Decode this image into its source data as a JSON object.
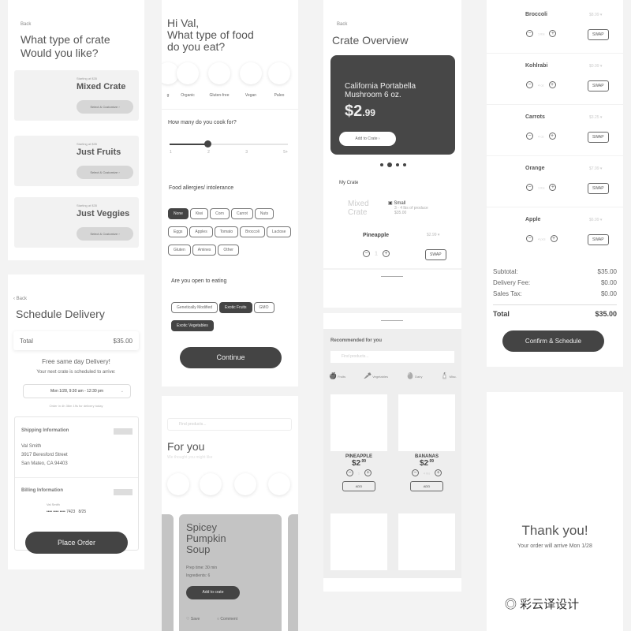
{
  "crate_select": {
    "back": "Back",
    "title_l1": "What type of crate",
    "title_l2": "Would you like?",
    "cards": [
      {
        "starting": "Starting at $35",
        "name": "Mixed Crate",
        "button": "Select & Customize"
      },
      {
        "starting": "Starting at $35",
        "name": "Just Fruits",
        "button": "Select & Customize"
      },
      {
        "starting": "Starting at $35",
        "name": "Just Veggies",
        "button": "Select & Customize"
      }
    ]
  },
  "food_prefs": {
    "title_l1": "Hi Val,",
    "title_l2": "What type of food",
    "title_l3": "do you eat?",
    "diets": [
      "g",
      "Organic",
      "Gluten-free",
      "Vegan",
      "Paleo"
    ],
    "cook_question": "How many do you cook for?",
    "slider_ticks": [
      "1",
      "2",
      "3",
      "5+"
    ],
    "slider_value": "2",
    "allergy_title": "Food allergies/ intolerance",
    "allergies": [
      {
        "l": "None",
        "on": true
      },
      {
        "l": "Kiwi"
      },
      {
        "l": "Corn"
      },
      {
        "l": "Carrot"
      },
      {
        "l": "Nuts"
      },
      {
        "l": "Eggs"
      },
      {
        "l": "Apples"
      },
      {
        "l": "Tomato"
      },
      {
        "l": "Broccoli"
      },
      {
        "l": "Lactose"
      },
      {
        "l": "Gluten"
      },
      {
        "l": "Amines"
      },
      {
        "l": "Other"
      }
    ],
    "open_title": "Are you open to eating",
    "open": [
      {
        "l": "Genetically Modified"
      },
      {
        "l": "Exotic Fruits",
        "on": true
      },
      {
        "l": "GMO"
      },
      {
        "l": "Exotic Vegetables",
        "on": true
      }
    ],
    "continue": "Continue"
  },
  "overview": {
    "back": "Back",
    "title": "Crate Overview",
    "featured_l1": "California Portabella",
    "featured_l2": "Mushroom 6 oz.",
    "price_main": "$2",
    "price_cents": ".99",
    "add": "Add to Crate",
    "my_crate": "My Crate",
    "crate_name_l1": "Mixed",
    "crate_name_l2": "Crate",
    "size": "Small",
    "size_desc": "3 - 4 lbs of produce",
    "size_price": "$35.00",
    "item": {
      "name": "Pineapple",
      "price": "$2.99",
      "qty": "1",
      "swap": "SWAP"
    }
  },
  "crate_list": {
    "items": [
      {
        "name": "Broccoli",
        "price": "$8.99",
        "qty": "1 lbs"
      },
      {
        "name": "Kohlrabi",
        "price": "$0.99",
        "qty": "4 oz"
      },
      {
        "name": "Carrots",
        "price": "$3.25",
        "qty": "4 oz"
      },
      {
        "name": "Orange",
        "price": "$7.99",
        "qty": "1 lbs"
      },
      {
        "name": "Apple",
        "price": "$6.99",
        "qty": "4 pcs"
      }
    ],
    "swap": "SWAP",
    "subtotal_label": "Subtotal:",
    "subtotal": "$35.00",
    "fee_label": "Delivery Fee:",
    "fee": "$0.00",
    "tax_label": "Sales Tax:",
    "tax": "$0.00",
    "total_label": "Total",
    "total": "$35.00",
    "confirm": "Confirm & Schedule"
  },
  "schedule": {
    "back": "Back",
    "title": "Schedule Delivery",
    "total_label": "Total",
    "total": "$35.00",
    "free": "Free same day Delivery!",
    "next": "Your next crate is scheduled to arrive:",
    "slot": "Mon 1/28, 9:30 am - 12:30 pm",
    "order_by": "Order in 4h 36m 19s for delivery today",
    "ship_title": "Shipping Information",
    "ship_name": "Val Smith",
    "ship_street": "3917 Beresford Street",
    "ship_city": "San Mateo, CA 94403",
    "bill_title": "Billing Information",
    "bill_name": "Val Smith",
    "card_mask": "•••• •••• ••••",
    "card_last": "7423",
    "card_exp": "8/25",
    "place": "Place Order"
  },
  "for_you": {
    "search_placeholder": "Find products...",
    "title": "For you",
    "subtitle": "We thought you might like",
    "recipe": {
      "l1": "Spicey",
      "l2": "Pumpkin",
      "l3": "Soup",
      "prep": "Prep time: 30 min",
      "ingredients": "Ingredients: 6",
      "add": "Add to crate",
      "save": "Save",
      "comment": "Comment"
    }
  },
  "recommended": {
    "title": "Recommended for you",
    "search_placeholder": "Find products...",
    "categories": [
      "Fruits",
      "Vegetables",
      "Dairy",
      "Misc."
    ],
    "products": [
      {
        "name": "PINEAPPLE",
        "price": "$2",
        "cents": ".99",
        "qty": "1",
        "add": "ADD"
      },
      {
        "name": "BANANAS",
        "price": "$2",
        "cents": ".99",
        "qty": "4 lbs",
        "add": "ADD"
      }
    ]
  },
  "thanks": {
    "title": "Thank you!",
    "sub": "Your order will arrive  Mon 1/28"
  },
  "watermark": "彩云译设计"
}
